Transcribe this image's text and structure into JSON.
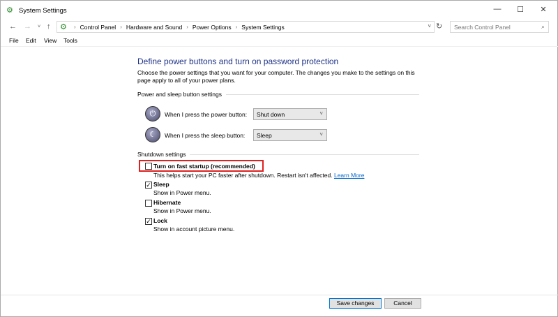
{
  "window": {
    "title": "System Settings",
    "minimize_icon": "minimize-icon",
    "maximize_icon": "maximize-icon",
    "close_icon": "close-icon"
  },
  "address": {
    "breadcrumb": [
      "Control Panel",
      "Hardware and Sound",
      "Power Options",
      "System Settings"
    ],
    "search_placeholder": "Search Control Panel"
  },
  "menu": [
    "File",
    "Edit",
    "View",
    "Tools"
  ],
  "main": {
    "heading": "Define power buttons and turn on password protection",
    "description": "Choose the power settings that you want for your computer. The changes you make to the settings on this page apply to all of your power plans.",
    "power_group": "Power and sleep button settings",
    "power_label": "When I press the power button:",
    "power_value": "Shut down",
    "sleep_label": "When I press the sleep button:",
    "sleep_value": "Sleep",
    "shutdown_group": "Shutdown settings",
    "options": [
      {
        "label": "Turn on fast startup (recommended)",
        "desc": "This helps start your PC faster after shutdown. Restart isn't affected.",
        "link": "Learn More",
        "checked": false
      },
      {
        "label": "Sleep",
        "desc": "Show in Power menu.",
        "checked": true
      },
      {
        "label": "Hibernate",
        "desc": "Show in Power menu.",
        "checked": false
      },
      {
        "label": "Lock",
        "desc": "Show in account picture menu.",
        "checked": true
      }
    ],
    "highlight_color": "#e02020"
  },
  "footer": {
    "save": "Save changes",
    "cancel": "Cancel"
  }
}
